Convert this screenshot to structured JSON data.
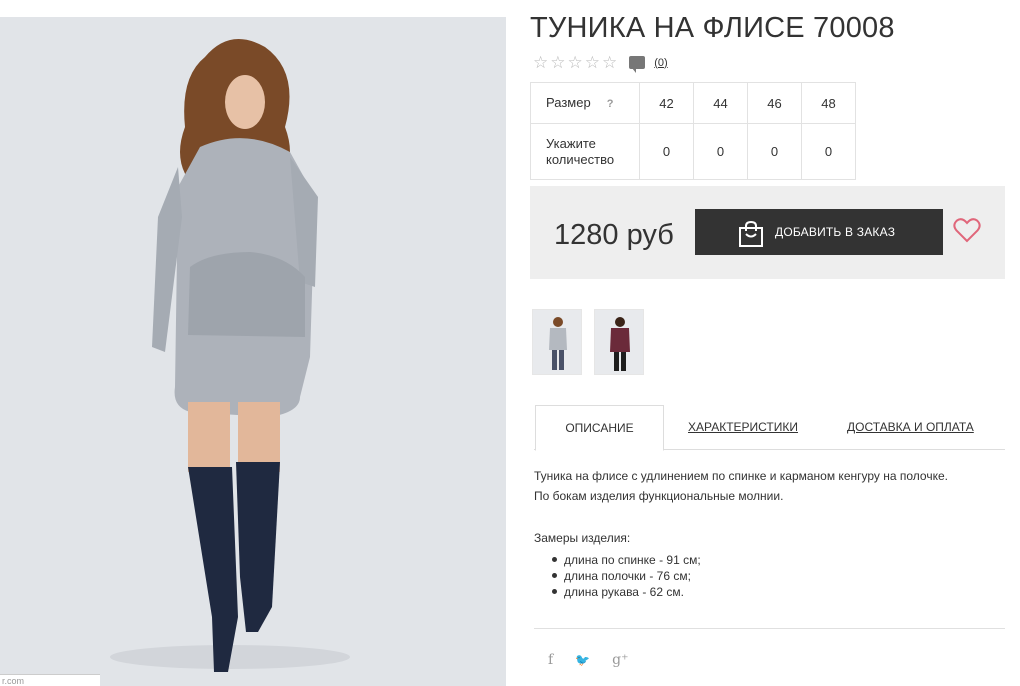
{
  "product": {
    "title": "ТУНИКА НА ФЛИСЕ 70008",
    "review_count": "(0)",
    "price": "1280 руб",
    "add_to_order_label": "ДОБАВИТЬ В ЗАКАЗ",
    "photo_caption": "r.com"
  },
  "rating": {
    "stars": 0,
    "max": 5,
    "star_glyph": "☆"
  },
  "size_table": {
    "size_label": "Размер",
    "size_help": "?",
    "sizes": [
      "42",
      "44",
      "46",
      "48"
    ],
    "qty_label_line1": "Укажите",
    "qty_label_line2": "количество",
    "quantities": [
      "0",
      "0",
      "0",
      "0"
    ]
  },
  "tabs": [
    {
      "label": "ОПИСАНИЕ",
      "active": true
    },
    {
      "label": "ХАРАКТЕРИСТИКИ",
      "active": false
    },
    {
      "label": "ДОСТАВКА И ОПЛАТА",
      "active": false
    }
  ],
  "description": {
    "line1": "Туника на флисе с удлинением по спинке и карманом кенгуру на полочке.",
    "line2": "По бокам изделия функциональные молнии.",
    "measures_title": "Замеры изделия:",
    "measures": [
      "длина по спинке - 91 см;",
      "длина полочки - 76 см;",
      "длина рукава - 62 см."
    ]
  },
  "social": {
    "facebook": "f",
    "twitter": "🐦",
    "google": "g⁺"
  },
  "colors": {
    "accent_dark": "#333333",
    "heart": "#e0667a",
    "panel_bg": "#eeeeee"
  },
  "icons": [
    "star-icon",
    "comment-icon",
    "shopping-bag-icon",
    "heart-icon",
    "facebook-icon",
    "twitter-icon",
    "google-plus-icon"
  ]
}
